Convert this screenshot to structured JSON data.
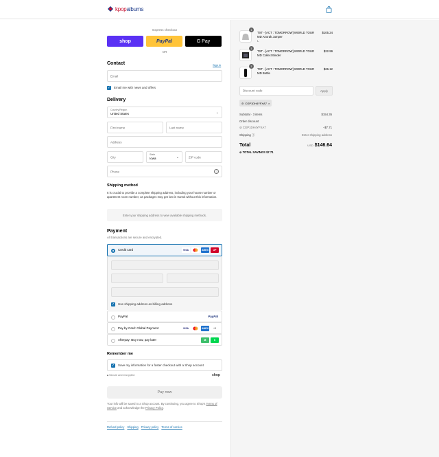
{
  "header": {
    "logo_text_k": "kpop",
    "logo_text_a": "albums"
  },
  "express": {
    "label": "Express checkout",
    "shop_label": "shop",
    "paypal_label": "PayPal",
    "gpay_label": "G Pay",
    "or_label": "OR"
  },
  "contact": {
    "title": "Contact",
    "sign_in": "Sign in",
    "email_placeholder": "Email",
    "news_label": "Email me with news and offers"
  },
  "delivery": {
    "title": "Delivery",
    "country_label": "Country/Region",
    "country_value": "United States",
    "first_name": "First name",
    "last_name": "Last name",
    "address": "Address",
    "city": "City",
    "state_label": "State",
    "state_value": "Iowa",
    "zip": "ZIP code",
    "phone": "Phone"
  },
  "shipping": {
    "title": "Shipping method",
    "note": "It is crucial to provide a complete shipping address, including your house number or apartment room number, as packages may get lost in transit without this information.",
    "placeholder_box": "Enter your shipping address to view available shipping methods."
  },
  "payment": {
    "title": "Payment",
    "subtitle": "All transactions are secure and encrypted.",
    "options": [
      {
        "label": "Credit card"
      },
      {
        "label": "PayPal"
      },
      {
        "label": "Pay by Card: Global Payment"
      },
      {
        "label": "Afterpay: Buy now, pay later"
      }
    ],
    "billing_label": "Use shipping address as billing address",
    "card_icons": [
      "VISA",
      "MC",
      "AMEX",
      "UP"
    ],
    "more_cards": "+3"
  },
  "remember": {
    "title": "Remember me",
    "save_label": "Save my information for a faster checkout with a Shop account",
    "secure_label": "Secure and encrypted",
    "shop_label": "shop"
  },
  "pay_now": "Pay now",
  "legal": {
    "line1": "Your info will be saved to a Shop account. By continuing, you agree to Shop's",
    "tos": "Terms of Service",
    "and": "and acknowledge the",
    "privacy": "Privacy Policy",
    "period": "."
  },
  "footer_links": [
    "Refund policy",
    "Shipping",
    "Privacy policy",
    "Terms of service"
  ],
  "summary": {
    "items": [
      {
        "qty": "1",
        "name": "TXT - [ACT : TOMORROW] WORLD TOUR MD Anorak Jumper",
        "variant": "L",
        "price": "$105.24"
      },
      {
        "qty": "1",
        "name": "TXT - [ACT : TOMORROW] WORLD TOUR MD Collect Binder",
        "variant": "",
        "price": "$22.99"
      },
      {
        "qty": "1",
        "name": "TXT - [ACT : TOMORROW] WORLD TOUR MD Bottle",
        "variant": "",
        "price": "$26.12"
      }
    ],
    "discount_placeholder": "Discount code",
    "apply": "Apply",
    "code": "CGP1DH4YFXA7",
    "subtotal_label": "Subtotal · 3 items",
    "subtotal_value": "$154.35",
    "order_discount_label": "Order discount",
    "discount_code": "CGP1DH4YFXA7",
    "discount_value": "−$7.71",
    "shipping_label": "Shipping",
    "shipping_value": "Enter shipping address",
    "total_label": "Total",
    "currency": "USD",
    "total_value": "$146.64",
    "savings_label": "TOTAL SAVINGS",
    "savings_value": "$7.71"
  },
  "colors": {
    "accent": "#1773b0",
    "shop_purple": "#5a31f4",
    "paypal_yellow": "#ffc439"
  }
}
